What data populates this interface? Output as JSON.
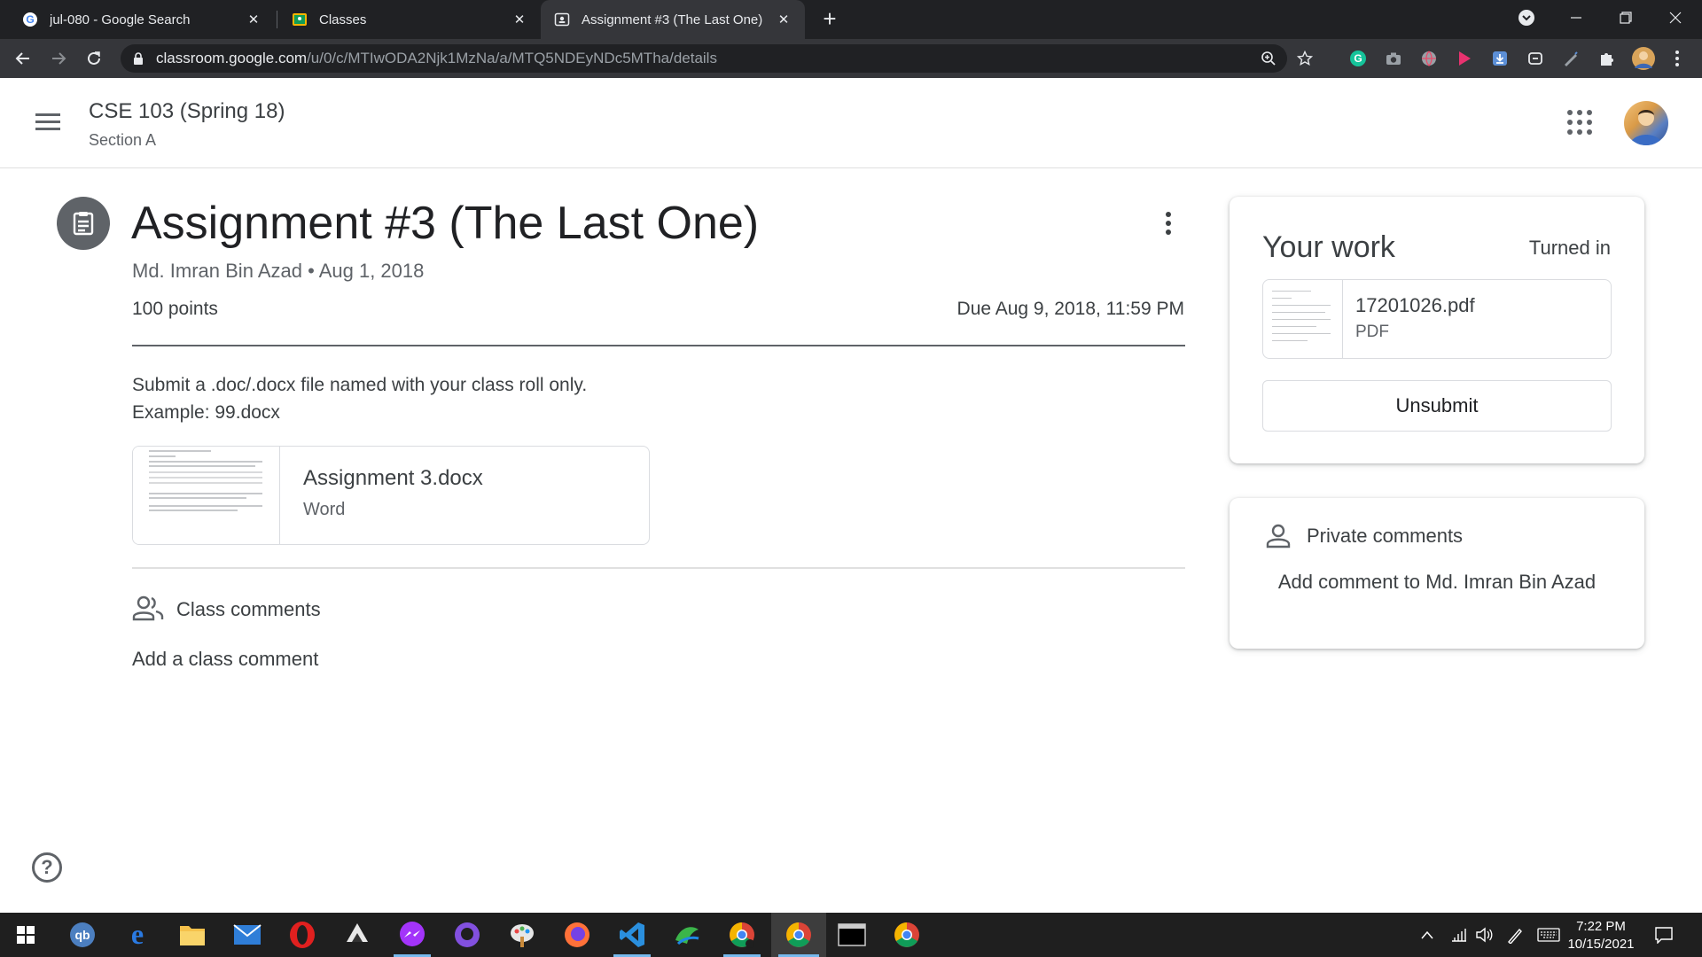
{
  "browser": {
    "tabs": [
      {
        "title": "jul-080 - Google Search",
        "icon": "google-g-icon"
      },
      {
        "title": "Classes",
        "icon": "classroom-icon"
      },
      {
        "title": "Assignment #3 (The Last One)",
        "icon": "classroom-assignment-icon",
        "active": true
      }
    ],
    "url_host": "classroom.google.com",
    "url_path": "/u/0/c/MTIwODA2Njk1MzNa/a/MTQ5NDEyNDc5MTha/details"
  },
  "classroom_header": {
    "class_name": "CSE 103 (Spring 18)",
    "section": "Section A"
  },
  "assignment": {
    "title": "Assignment #3 (The Last One)",
    "author": "Md. Imran Bin Azad",
    "date": "Aug 1, 2018",
    "separator": "•",
    "points": "100 points",
    "due": "Due Aug 9, 2018, 11:59 PM",
    "instructions": [
      "Submit a .doc/.docx file named with your class roll only.",
      "Example: 99.docx"
    ],
    "attachment": {
      "name": "Assignment 3.docx",
      "type": "Word"
    }
  },
  "class_comments": {
    "label": "Class comments",
    "add": "Add a class comment"
  },
  "your_work": {
    "title": "Your work",
    "status": "Turned in",
    "file": {
      "name": "17201026.pdf",
      "type": "PDF"
    },
    "unsubmit_label": "Unsubmit"
  },
  "private_comments": {
    "label": "Private comments",
    "add": "Add comment to Md. Imran Bin Azad"
  },
  "taskbar": {
    "time": "7:22 PM",
    "date": "10/15/2021"
  },
  "colors": {
    "chrome_dark": "#202124",
    "toolbar": "#35363a",
    "text_primary": "#3c4043",
    "text_secondary": "#5f6368"
  }
}
